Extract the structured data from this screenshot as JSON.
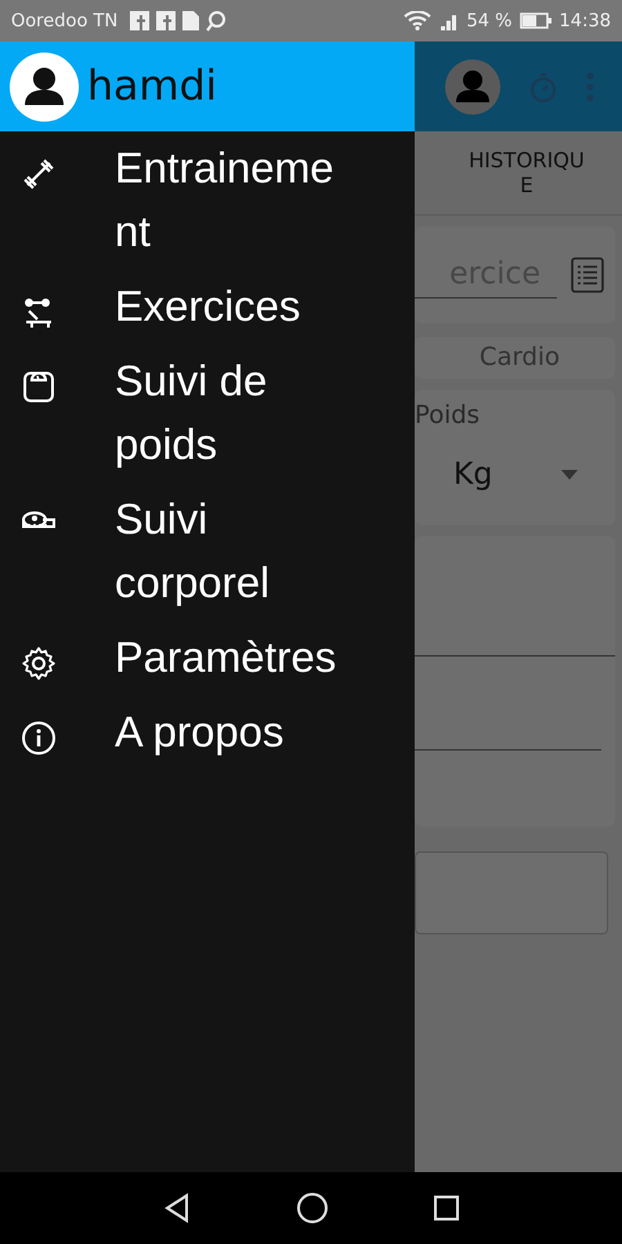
{
  "status_bar": {
    "carrier": "Ooredoo TN",
    "battery": "54 %",
    "time": "14:38"
  },
  "drawer": {
    "user": "hamdi",
    "items": [
      {
        "label": "Entrainement",
        "kind": "barbell"
      },
      {
        "label": "Exercices",
        "kind": "bench"
      },
      {
        "label": "Suivi de poids",
        "kind": "scale"
      },
      {
        "label": "Suivi corporel",
        "kind": "tape"
      },
      {
        "label": "Paramètres",
        "kind": "gear"
      },
      {
        "label": "A propos",
        "kind": "info"
      }
    ]
  },
  "background": {
    "tab": "HISTORIQUE",
    "field_placeholder": "ercice",
    "chip": "Cardio",
    "weight_label": "Poids",
    "unit": "Kg"
  }
}
